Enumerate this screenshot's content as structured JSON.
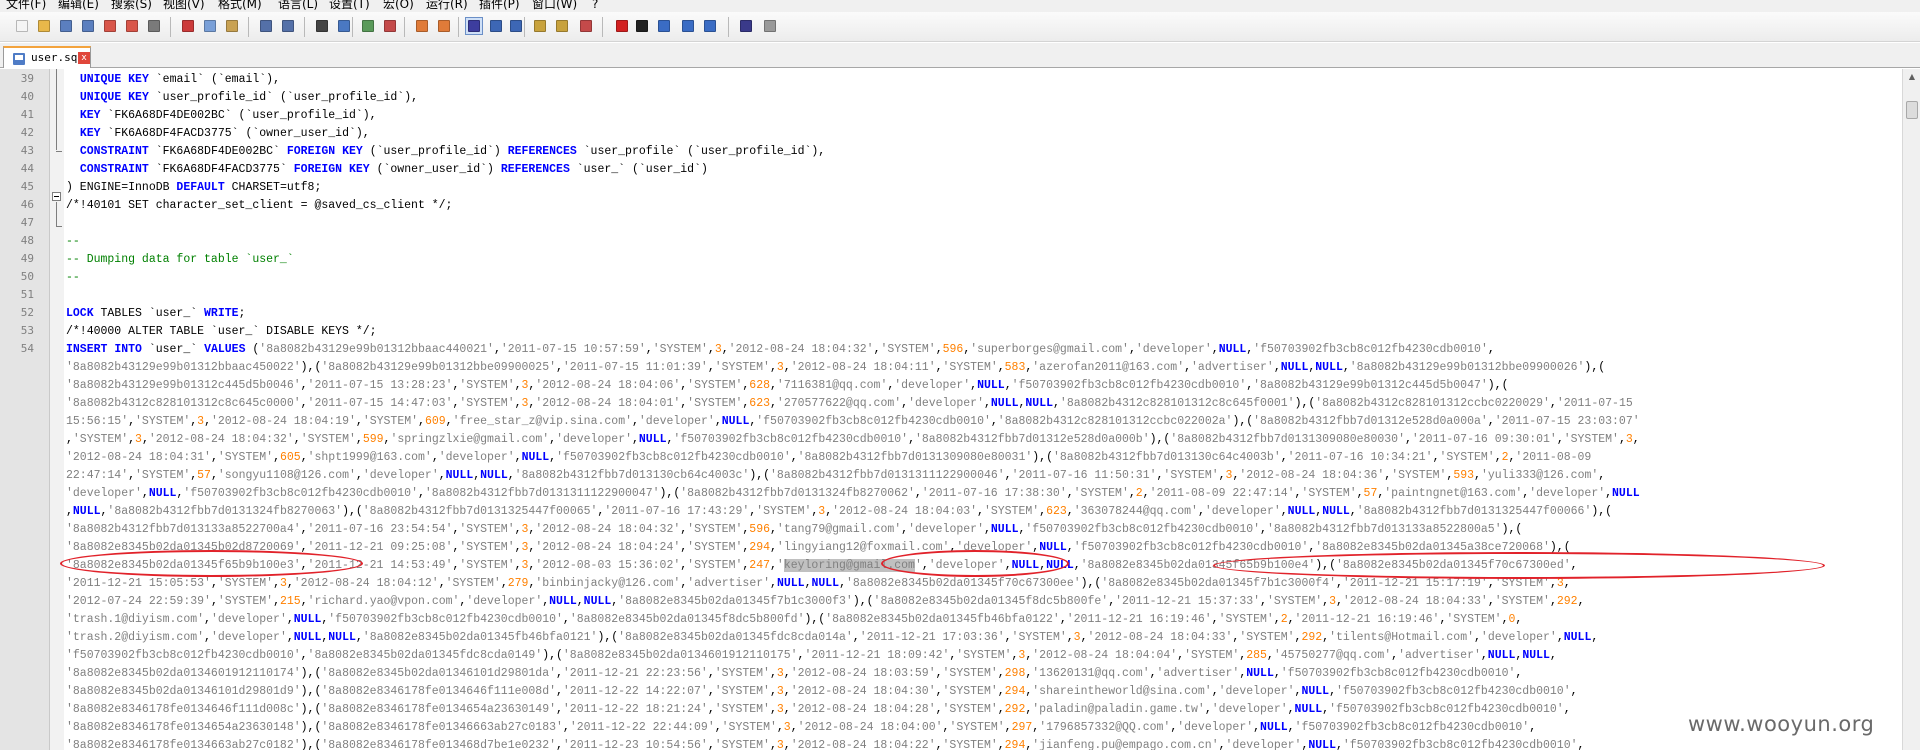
{
  "menu": [
    "文件(F)",
    "编辑(E)",
    "搜索(S)",
    "视图(V)",
    "格式(M)",
    "语言(L)",
    "设置(T)",
    "宏(O)",
    "运行(R)",
    "插件(P)",
    "窗口(W)",
    "?"
  ],
  "toolbar": {
    "buttons": [
      {
        "name": "new-file-icon",
        "color": "#f5f5f5"
      },
      {
        "name": "open-file-icon",
        "color": "#e8b84a"
      },
      {
        "name": "save-icon",
        "color": "#5b7fbf"
      },
      {
        "name": "save-all-icon",
        "color": "#5b7fbf"
      },
      {
        "name": "close-file-icon",
        "color": "#d9564a"
      },
      {
        "name": "close-all-icon",
        "color": "#d9564a"
      },
      {
        "name": "print-icon",
        "color": "#7a7a7a"
      },
      {
        "name": "cut-icon",
        "color": "#cc3b3b"
      },
      {
        "name": "copy-icon",
        "color": "#7aa0d8"
      },
      {
        "name": "paste-icon",
        "color": "#c9a253"
      },
      {
        "name": "undo-icon",
        "color": "#5470a8"
      },
      {
        "name": "redo-icon",
        "color": "#5470a8"
      },
      {
        "name": "find-icon",
        "color": "#444444"
      },
      {
        "name": "replace-icon",
        "color": "#4a78c2"
      },
      {
        "name": "zoom-in-icon",
        "color": "#5a9a5a"
      },
      {
        "name": "zoom-out-icon",
        "color": "#c44a4a"
      },
      {
        "name": "sync-vertical-icon",
        "color": "#e07b39"
      },
      {
        "name": "sync-horizontal-icon",
        "color": "#e07b39"
      },
      {
        "name": "word-wrap-icon",
        "color": "#3d3d9e"
      },
      {
        "name": "show-all-chars-icon",
        "color": "#3d67b5"
      },
      {
        "name": "indent-guide-icon",
        "color": "#3d67b5"
      },
      {
        "name": "udl-icon",
        "color": "#c8a23d"
      },
      {
        "name": "doc-map-icon",
        "color": "#c8a23d"
      },
      {
        "name": "function-list-icon",
        "color": "#c44a4a"
      },
      {
        "name": "record-macro-icon",
        "color": "#d22020"
      },
      {
        "name": "stop-record-icon",
        "color": "#222222"
      },
      {
        "name": "play-macro-icon",
        "color": "#3a6cc4"
      },
      {
        "name": "run-macro-multiple-icon",
        "color": "#3a6cc4"
      },
      {
        "name": "save-macro-icon",
        "color": "#3a6cc4"
      },
      {
        "name": "spell-check-icon",
        "color": "#3a3a8a"
      },
      {
        "name": "plugin-icon",
        "color": "#999999"
      }
    ]
  },
  "tab": {
    "name": "user.sql",
    "close_glyph": "x"
  },
  "editor": {
    "lines": [
      {
        "n": "39",
        "html": "  <span class=\"kw\">UNIQUE</span> <span class=\"kw\">KEY</span> `email` (`email`),"
      },
      {
        "n": "40",
        "html": "  <span class=\"kw\">UNIQUE</span> <span class=\"kw\">KEY</span> `user_profile_id` (`user_profile_id`),"
      },
      {
        "n": "41",
        "html": "  <span class=\"kw\">KEY</span> `FK6A68DF4DE002BC` (`user_profile_id`),"
      },
      {
        "n": "42",
        "html": "  <span class=\"kw\">KEY</span> `FK6A68DF4FACD3775` (`owner_user_id`),"
      },
      {
        "n": "43",
        "html": "  <span class=\"kw\">CONSTRAINT</span> `FK6A68DF4DE002BC` <span class=\"kw\">FOREIGN</span> <span class=\"kw\">KEY</span> (`user_profile_id`) <span class=\"kw\">REFERENCES</span> `user_profile` (`user_profile_id`),"
      },
      {
        "n": "44",
        "html": "  <span class=\"kw\">CONSTRAINT</span> `FK6A68DF4FACD3775` <span class=\"kw\">FOREIGN</span> <span class=\"kw\">KEY</span> (`owner_user_id`) <span class=\"kw\">REFERENCES</span> `user_` (`user_id`)"
      },
      {
        "n": "45",
        "html": ") ENGINE=InnoDB <span class=\"kw\">DEFAULT</span> CHARSET=utf8;"
      },
      {
        "n": "46",
        "html": "/*!40101 SET character_set_client = @saved_cs_client */;"
      },
      {
        "n": "47",
        "html": ""
      },
      {
        "n": "48",
        "html": "<span class=\"cm\">--</span>"
      },
      {
        "n": "49",
        "html": "<span class=\"cm\">-- Dumping data for table `user_`</span>"
      },
      {
        "n": "50",
        "html": "<span class=\"cm\">--</span>"
      },
      {
        "n": "51",
        "html": ""
      },
      {
        "n": "52",
        "html": "<span class=\"kw\">LOCK</span> TABLES `user_` <span class=\"kw\">WRITE</span>;"
      },
      {
        "n": "53",
        "html": "/*!40000 ALTER TABLE `user_` DISABLE KEYS */;"
      },
      {
        "n": "54",
        "html": "<span class=\"kw\">INSERT</span> <span class=\"kw\">INTO</span> `user_` <span class=\"kw\">VALUES</span> (<span class=\"str\">'8a8082b43129e99b01312bbaac440021'</span>,<span class=\"str\">'2011-07-15 10:57:59'</span>,<span class=\"str\">'SYSTEM'</span>,<span class=\"n\">3</span>,<span class=\"str\">'2012-08-24 18:04:32'</span>,<span class=\"str\">'SYSTEM'</span>,<span class=\"n\">596</span>,<span class=\"str\">'superborges@gmail.com'</span>,<span class=\"str\">'developer'</span>,<span class=\"nl\">NULL</span>,<span class=\"str\">'f50703902fb3cb8c012fb4230cdb0010'</span>,"
      },
      {
        "n": "",
        "html": "<span class=\"str\">'8a8082b43129e99b01312bbaac450022'</span>),(<span class=\"str\">'8a8082b43129e99b01312bbe09900025'</span>,<span class=\"str\">'2011-07-15 11:01:39'</span>,<span class=\"str\">'SYSTEM'</span>,<span class=\"n\">3</span>,<span class=\"str\">'2012-08-24 18:04:11'</span>,<span class=\"str\">'SYSTEM'</span>,<span class=\"n\">583</span>,<span class=\"str\">'azerofan2011@163.com'</span>,<span class=\"str\">'advertiser'</span>,<span class=\"nl\">NULL</span>,<span class=\"nl\">NULL</span>,<span class=\"str\">'8a8082b43129e99b01312bbe09900026'</span>),("
      },
      {
        "n": "",
        "html": "<span class=\"str\">'8a8082b43129e99b01312c445d5b0046'</span>,<span class=\"str\">'2011-07-15 13:28:23'</span>,<span class=\"str\">'SYSTEM'</span>,<span class=\"n\">3</span>,<span class=\"str\">'2012-08-24 18:04:06'</span>,<span class=\"str\">'SYSTEM'</span>,<span class=\"n\">628</span>,<span class=\"str\">'7116381@qq.com'</span>,<span class=\"str\">'developer'</span>,<span class=\"nl\">NULL</span>,<span class=\"str\">'f50703902fb3cb8c012fb4230cdb0010'</span>,<span class=\"str\">'8a8082b43129e99b01312c445d5b0047'</span>),("
      },
      {
        "n": "",
        "html": "<span class=\"str\">'8a8082b4312c828101312c8c645c0000'</span>,<span class=\"str\">'2011-07-15 14:47:03'</span>,<span class=\"str\">'SYSTEM'</span>,<span class=\"n\">3</span>,<span class=\"str\">'2012-08-24 18:04:01'</span>,<span class=\"str\">'SYSTEM'</span>,<span class=\"n\">623</span>,<span class=\"str\">'270577622@qq.com'</span>,<span class=\"str\">'developer'</span>,<span class=\"nl\">NULL</span>,<span class=\"nl\">NULL</span>,<span class=\"str\">'8a8082b4312c828101312c8c645f0001'</span>),(<span class=\"str\">'8a8082b4312c828101312ccbc0220029'</span>,<span class=\"str\">'2011-07-15</span>"
      },
      {
        "n": "",
        "html": "<span class=\"str\">15:56:15'</span>,<span class=\"str\">'SYSTEM'</span>,<span class=\"n\">3</span>,<span class=\"str\">'2012-08-24 18:04:19'</span>,<span class=\"str\">'SYSTEM'</span>,<span class=\"n\">609</span>,<span class=\"str\">'free_star_z@vip.sina.com'</span>,<span class=\"str\">'developer'</span>,<span class=\"nl\">NULL</span>,<span class=\"str\">'f50703902fb3cb8c012fb4230cdb0010'</span>,<span class=\"str\">'8a8082b4312c828101312ccbc022002a'</span>),(<span class=\"str\">'8a8082b4312fbb7d01312e528d0a000a'</span>,<span class=\"str\">'2011-07-15 23:03:07'</span>"
      },
      {
        "n": "",
        "html": ",<span class=\"str\">'SYSTEM'</span>,<span class=\"n\">3</span>,<span class=\"str\">'2012-08-24 18:04:32'</span>,<span class=\"str\">'SYSTEM'</span>,<span class=\"n\">599</span>,<span class=\"str\">'springzlxie@gmail.com'</span>,<span class=\"str\">'developer'</span>,<span class=\"nl\">NULL</span>,<span class=\"str\">'f50703902fb3cb8c012fb4230cdb0010'</span>,<span class=\"str\">'8a8082b4312fbb7d01312e528d0a000b'</span>),(<span class=\"str\">'8a8082b4312fbb7d0131309080e80030'</span>,<span class=\"str\">'2011-07-16 09:30:01'</span>,<span class=\"str\">'SYSTEM'</span>,<span class=\"n\">3</span>,"
      },
      {
        "n": "",
        "html": "<span class=\"str\">'2012-08-24 18:04:31'</span>,<span class=\"str\">'SYSTEM'</span>,<span class=\"n\">605</span>,<span class=\"str\">'shpt1999@163.com'</span>,<span class=\"str\">'developer'</span>,<span class=\"nl\">NULL</span>,<span class=\"str\">'f50703902fb3cb8c012fb4230cdb0010'</span>,<span class=\"str\">'8a8082b4312fbb7d0131309080e80031'</span>),(<span class=\"str\">'8a8082b4312fbb7d013130c64c4003b'</span>,<span class=\"str\">'2011-07-16 10:34:21'</span>,<span class=\"str\">'SYSTEM'</span>,<span class=\"n\">2</span>,<span class=\"str\">'2011-08-09</span>"
      },
      {
        "n": "",
        "html": "<span class=\"str\">22:47:14'</span>,<span class=\"str\">'SYSTEM'</span>,<span class=\"n\">57</span>,<span class=\"str\">'songyu1108@126.com'</span>,<span class=\"str\">'developer'</span>,<span class=\"nl\">NULL</span>,<span class=\"nl\">NULL</span>,<span class=\"str\">'8a8082b4312fbb7d013130cb64c4003c'</span>),(<span class=\"str\">'8a8082b4312fbb7d0131311122900046'</span>,<span class=\"str\">'2011-07-16 11:50:31'</span>,<span class=\"str\">'SYSTEM'</span>,<span class=\"n\">3</span>,<span class=\"str\">'2012-08-24 18:04:36'</span>,<span class=\"str\">'SYSTEM'</span>,<span class=\"n\">593</span>,<span class=\"str\">'yuli333@126.com'</span>,"
      },
      {
        "n": "",
        "html": "<span class=\"str\">'developer'</span>,<span class=\"nl\">NULL</span>,<span class=\"str\">'f50703902fb3cb8c012fb4230cdb0010'</span>,<span class=\"str\">'8a8082b4312fbb7d0131311122900047'</span>),(<span class=\"str\">'8a8082b4312fbb7d0131324fb8270062'</span>,<span class=\"str\">'2011-07-16 17:38:30'</span>,<span class=\"str\">'SYSTEM'</span>,<span class=\"n\">2</span>,<span class=\"str\">'2011-08-09 22:47:14'</span>,<span class=\"str\">'SYSTEM'</span>,<span class=\"n\">57</span>,<span class=\"str\">'paintngnet@163.com'</span>,<span class=\"str\">'developer'</span>,<span class=\"nl\">NULL</span>"
      },
      {
        "n": "",
        "html": ",<span class=\"nl\">NULL</span>,<span class=\"str\">'8a8082b4312fbb7d0131324fb8270063'</span>),(<span class=\"str\">'8a8082b4312fbb7d0131325447f00065'</span>,<span class=\"str\">'2011-07-16 17:43:29'</span>,<span class=\"str\">'SYSTEM'</span>,<span class=\"n\">3</span>,<span class=\"str\">'2012-08-24 18:04:03'</span>,<span class=\"str\">'SYSTEM'</span>,<span class=\"n\">623</span>,<span class=\"str\">'363078244@qq.com'</span>,<span class=\"str\">'developer'</span>,<span class=\"nl\">NULL</span>,<span class=\"nl\">NULL</span>,<span class=\"str\">'8a8082b4312fbb7d0131325447f00066'</span>),("
      },
      {
        "n": "",
        "html": "<span class=\"str\">'8a8082b4312fbb7d013133a8522700a4'</span>,<span class=\"str\">'2011-07-16 23:54:54'</span>,<span class=\"str\">'SYSTEM'</span>,<span class=\"n\">3</span>,<span class=\"str\">'2012-08-24 18:04:32'</span>,<span class=\"str\">'SYSTEM'</span>,<span class=\"n\">596</span>,<span class=\"str\">'tang79@gmail.com'</span>,<span class=\"str\">'developer'</span>,<span class=\"nl\">NULL</span>,<span class=\"str\">'f50703902fb3cb8c012fb4230cdb0010'</span>,<span class=\"str\">'8a8082b4312fbb7d013133a8522800a5'</span>),("
      },
      {
        "n": "",
        "html": "<span class=\"str\">'8a8082e8345b02da01345b02d8720069'</span>,<span class=\"str\">'2011-12-21 09:25:08'</span>,<span class=\"str\">'SYSTEM'</span>,<span class=\"n\">3</span>,<span class=\"str\">'2012-08-24 18:04:24'</span>,<span class=\"str\">'SYSTEM'</span>,<span class=\"n\">294</span>,<span class=\"str\">'lingyiang12@foxmail.com'</span>,<span class=\"str\">'developer'</span>,<span class=\"nl\">NULL</span>,<span class=\"str\">'f50703902fb3cb8c012fb4230cdb0010'</span>,<span class=\"str\">'8a8082e8345b02da01345a38ce720068'</span>),("
      },
      {
        "n": "",
        "html": "<span class=\"str\">'8a8082e8345b02da01345f65b9b100e3'</span>,<span class=\"str\">'2011-12-21 14:53:49'</span>,<span class=\"str\">'SYSTEM'</span>,<span class=\"n\">3</span>,<span class=\"str\">'2012-08-03 15:36:02'</span>,<span class=\"str\">'SYSTEM'</span>,<span class=\"n\">247</span>,<span class=\"str\">'<span class=\"sel\">keyloring@gmail.com</span>'</span>,<span class=\"str\">'developer'</span>,<span class=\"nl\">NULL</span>,<span class=\"nl\">NULL</span>,<span class=\"str\">'8a8082e8345b02da01345f65b9b100e4'</span>),(<span class=\"str\">'8a8082e8345b02da01345f70c67300ed'</span>,"
      },
      {
        "n": "",
        "html": "<span class=\"str\">'2011-12-21 15:05:53'</span>,<span class=\"str\">'SYSTEM'</span>,<span class=\"n\">3</span>,<span class=\"str\">'2012-08-24 18:04:12'</span>,<span class=\"str\">'SYSTEM'</span>,<span class=\"n\">279</span>,<span class=\"str\">'binbinjacky@126.com'</span>,<span class=\"str\">'advertiser'</span>,<span class=\"nl\">NULL</span>,<span class=\"nl\">NULL</span>,<span class=\"str\">'8a8082e8345b02da01345f70c67300ee'</span>),(<span class=\"str\">'8a8082e8345b02da01345f7b1c3000f4'</span>,<span class=\"str\">'2011-12-21 15:17:19'</span>,<span class=\"str\">'SYSTEM'</span>,<span class=\"n\">3</span>,"
      },
      {
        "n": "",
        "html": "<span class=\"str\">'2012-07-24 22:59:39'</span>,<span class=\"str\">'SYSTEM'</span>,<span class=\"n\">215</span>,<span class=\"str\">'richard.yao@vpon.com'</span>,<span class=\"str\">'developer'</span>,<span class=\"nl\">NULL</span>,<span class=\"nl\">NULL</span>,<span class=\"str\">'8a8082e8345b02da01345f7b1c3000f3'</span>),(<span class=\"str\">'8a8082e8345b02da01345f8dc5b800fe'</span>,<span class=\"str\">'2011-12-21 15:37:33'</span>,<span class=\"str\">'SYSTEM'</span>,<span class=\"n\">3</span>,<span class=\"str\">'2012-08-24 18:04:33'</span>,<span class=\"str\">'SYSTEM'</span>,<span class=\"n\">292</span>,"
      },
      {
        "n": "",
        "html": "<span class=\"str\">'trash.1@diyism.com'</span>,<span class=\"str\">'developer'</span>,<span class=\"nl\">NULL</span>,<span class=\"str\">'f50703902fb3cb8c012fb4230cdb0010'</span>,<span class=\"str\">'8a8082e8345b02da01345f8dc5b800fd'</span>),(<span class=\"str\">'8a8082e8345b02da01345fb46bfa0122'</span>,<span class=\"str\">'2011-12-21 16:19:46'</span>,<span class=\"str\">'SYSTEM'</span>,<span class=\"n\">2</span>,<span class=\"str\">'2011-12-21 16:19:46'</span>,<span class=\"str\">'SYSTEM'</span>,<span class=\"n\">0</span>,"
      },
      {
        "n": "",
        "html": "<span class=\"str\">'trash.2@diyism.com'</span>,<span class=\"str\">'developer'</span>,<span class=\"nl\">NULL</span>,<span class=\"nl\">NULL</span>,<span class=\"str\">'8a8082e8345b02da01345fb46bfa0121'</span>),(<span class=\"str\">'8a8082e8345b02da01345fdc8cda014a'</span>,<span class=\"str\">'2011-12-21 17:03:36'</span>,<span class=\"str\">'SYSTEM'</span>,<span class=\"n\">3</span>,<span class=\"str\">'2012-08-24 18:04:33'</span>,<span class=\"str\">'SYSTEM'</span>,<span class=\"n\">292</span>,<span class=\"str\">'tilents@Hotmail.com'</span>,<span class=\"str\">'developer'</span>,<span class=\"nl\">NULL</span>,"
      },
      {
        "n": "",
        "html": "<span class=\"str\">'f50703902fb3cb8c012fb4230cdb0010'</span>,<span class=\"str\">'8a8082e8345b02da01345fdc8cda0149'</span>),(<span class=\"str\">'8a8082e8345b02da0134601912110175'</span>,<span class=\"str\">'2011-12-21 18:09:42'</span>,<span class=\"str\">'SYSTEM'</span>,<span class=\"n\">3</span>,<span class=\"str\">'2012-08-24 18:04:04'</span>,<span class=\"str\">'SYSTEM'</span>,<span class=\"n\">285</span>,<span class=\"str\">'45750277@qq.com'</span>,<span class=\"str\">'advertiser'</span>,<span class=\"nl\">NULL</span>,<span class=\"nl\">NULL</span>,"
      },
      {
        "n": "",
        "html": "<span class=\"str\">'8a8082e8345b02da0134601912110174'</span>),(<span class=\"str\">'8a8082e8345b02da01346101d29801da'</span>,<span class=\"str\">'2011-12-21 22:23:56'</span>,<span class=\"str\">'SYSTEM'</span>,<span class=\"n\">3</span>,<span class=\"str\">'2012-08-24 18:03:59'</span>,<span class=\"str\">'SYSTEM'</span>,<span class=\"n\">298</span>,<span class=\"str\">'13620131@qq.com'</span>,<span class=\"str\">'advertiser'</span>,<span class=\"nl\">NULL</span>,<span class=\"str\">'f50703902fb3cb8c012fb4230cdb0010'</span>,"
      },
      {
        "n": "",
        "html": "<span class=\"str\">'8a8082e8345b02da01346101d29801d9'</span>),(<span class=\"str\">'8a8082e8346178fe0134646f111e008d'</span>,<span class=\"str\">'2011-12-22 14:22:07'</span>,<span class=\"str\">'SYSTEM'</span>,<span class=\"n\">3</span>,<span class=\"str\">'2012-08-24 18:04:30'</span>,<span class=\"str\">'SYSTEM'</span>,<span class=\"n\">294</span>,<span class=\"str\">'shareintheworld@sina.com'</span>,<span class=\"str\">'developer'</span>,<span class=\"nl\">NULL</span>,<span class=\"str\">'f50703902fb3cb8c012fb4230cdb0010'</span>,"
      },
      {
        "n": "",
        "html": "<span class=\"str\">'8a8082e8346178fe0134646f111d008c'</span>),(<span class=\"str\">'8a8082e8346178fe0134654a23630149'</span>,<span class=\"str\">'2011-12-22 18:21:24'</span>,<span class=\"str\">'SYSTEM'</span>,<span class=\"n\">3</span>,<span class=\"str\">'2012-08-24 18:04:28'</span>,<span class=\"str\">'SYSTEM'</span>,<span class=\"n\">292</span>,<span class=\"str\">'paladin@paladin.game.tw'</span>,<span class=\"str\">'developer'</span>,<span class=\"nl\">NULL</span>,<span class=\"str\">'f50703902fb3cb8c012fb4230cdb0010'</span>,"
      },
      {
        "n": "",
        "html": "<span class=\"str\">'8a8082e8346178fe0134654a23630148'</span>),(<span class=\"str\">'8a8082e8346178fe01346663ab27c0183'</span>,<span class=\"str\">'2011-12-22 22:44:09'</span>,<span class=\"str\">'SYSTEM'</span>,<span class=\"n\">3</span>,<span class=\"str\">'2012-08-24 18:04:00'</span>,<span class=\"str\">'SYSTEM'</span>,<span class=\"n\">297</span>,<span class=\"str\">'1796857332@QQ.com'</span>,<span class=\"str\">'developer'</span>,<span class=\"nl\">NULL</span>,<span class=\"str\">'f50703902fb3cb8c012fb4230cdb0010'</span>,"
      },
      {
        "n": "",
        "html": "<span class=\"str\">'8a8082e8346178fe0134663ab27c0182'</span>),(<span class=\"str\">'8a8082e8346178fe013468d7be1e0232'</span>,<span class=\"str\">'2011-12-23 10:54:56'</span>,<span class=\"str\">'SYSTEM'</span>,<span class=\"n\">3</span>,<span class=\"str\">'2012-08-24 18:04:22'</span>,<span class=\"str\">'SYSTEM'</span>,<span class=\"n\">294</span>,<span class=\"str\">'jianfeng.pu@empago.com.cn'</span>,<span class=\"str\">'developer'</span>,<span class=\"nl\">NULL</span>,<span class=\"str\">'f50703902fb3cb8c012fb4230cdb0010'</span>,"
      }
    ]
  },
  "watermark": "www.wooyun.org"
}
